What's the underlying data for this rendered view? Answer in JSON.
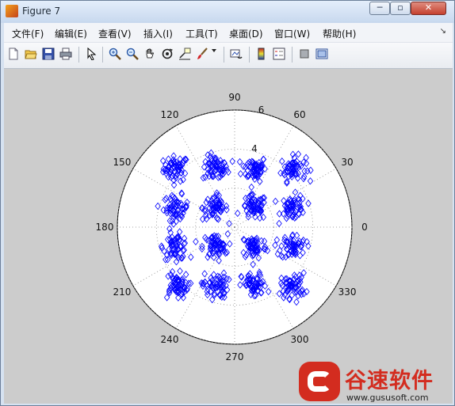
{
  "window": {
    "title": "Figure 7"
  },
  "caption_buttons": {
    "minimize": "─",
    "maximize": "▫",
    "close": "✕"
  },
  "menu": [
    "文件(F)",
    "编辑(E)",
    "查看(V)",
    "插入(I)",
    "工具(T)",
    "桌面(D)",
    "窗口(W)",
    "帮助(H)"
  ],
  "menu_overflow": "↘",
  "toolbar": [
    {
      "name": "new-figure-icon"
    },
    {
      "name": "open-file-icon"
    },
    {
      "name": "save-icon"
    },
    {
      "name": "print-icon"
    },
    {
      "name": "pointer-icon"
    },
    {
      "name": "zoom-in-icon"
    },
    {
      "name": "zoom-out-icon"
    },
    {
      "name": "pan-hand-icon"
    },
    {
      "name": "rotate-3d-icon"
    },
    {
      "name": "data-cursor-icon"
    },
    {
      "name": "brush-icon"
    },
    {
      "name": "brush-dropdown-icon"
    },
    {
      "name": "link-plot-icon"
    },
    {
      "name": "colorbar-icon"
    },
    {
      "name": "legend-icon"
    },
    {
      "name": "hide-plot-tools-icon"
    },
    {
      "name": "show-plot-tools-icon"
    }
  ],
  "chart_data": {
    "type": "scatter",
    "coordinate_system": "polar",
    "marker": "diamond",
    "color": "#0000ff",
    "angle_ticks": [
      "0",
      "30",
      "60",
      "90",
      "120",
      "150",
      "180",
      "210",
      "240",
      "270",
      "300",
      "330"
    ],
    "radial_ticks": [
      "4",
      "6"
    ],
    "rlim": [
      0,
      6
    ],
    "grid": true,
    "series": [
      {
        "cluster_centers": [
          {
            "x": -3,
            "y": 3
          },
          {
            "x": -1,
            "y": 3
          },
          {
            "x": 1,
            "y": 3
          },
          {
            "x": 3,
            "y": 3
          },
          {
            "x": -3,
            "y": 1
          },
          {
            "x": -1,
            "y": 1
          },
          {
            "x": 1,
            "y": 1
          },
          {
            "x": 3,
            "y": 1
          },
          {
            "x": -3,
            "y": -1
          },
          {
            "x": -1,
            "y": -1
          },
          {
            "x": 1,
            "y": -1
          },
          {
            "x": 3,
            "y": -1
          },
          {
            "x": -3,
            "y": -3
          },
          {
            "x": -1,
            "y": -3
          },
          {
            "x": 1,
            "y": -3
          },
          {
            "x": 3,
            "y": -3
          }
        ],
        "points_per_cluster": 60,
        "spread": 0.32
      }
    ]
  },
  "watermark": {
    "brand": "谷速软件",
    "url": "www.gususoft.com"
  }
}
